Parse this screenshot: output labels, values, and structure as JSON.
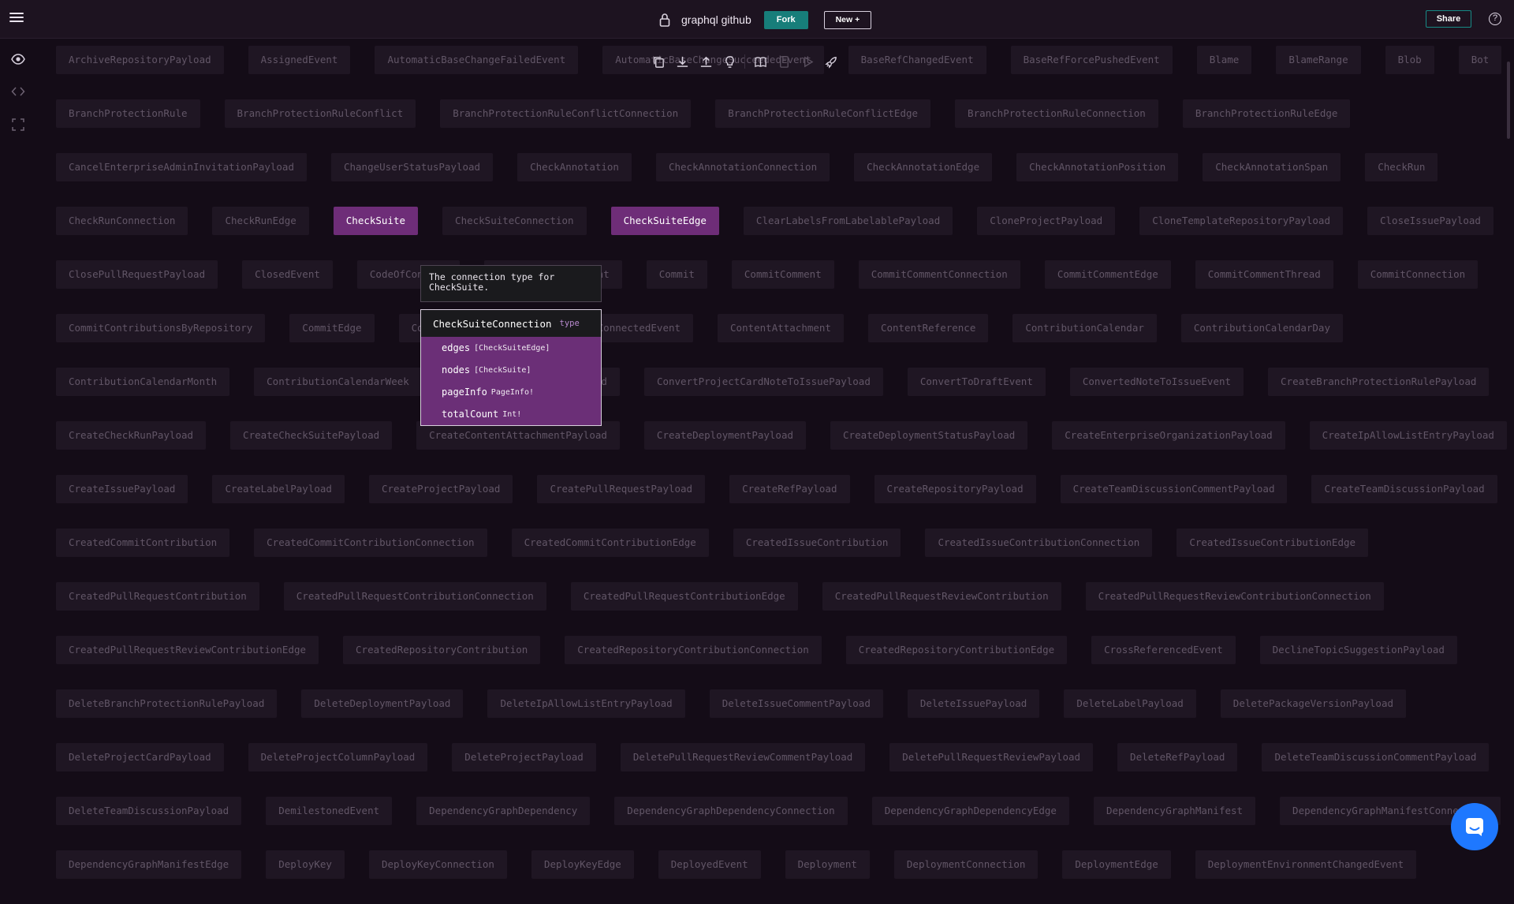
{
  "header": {
    "title": "graphql github",
    "fork_label": "Fork",
    "new_label": "New +",
    "share_label": "Share",
    "help_label": "?"
  },
  "rail": [
    "eye-icon",
    "code-icon",
    "fullscreen-icon"
  ],
  "toolbar": [
    "copy-icon",
    "download-icon",
    "upload-icon",
    "lightbulb-icon",
    "book-icon",
    "document-icon",
    "play-icon",
    "rocket-icon"
  ],
  "rows": [
    [
      "ArchiveRepositoryPayload",
      "AssignedEvent",
      "AutomaticBaseChangeFailedEvent",
      "AutomaticBaseChangeSucceededEvent",
      "BaseRefChangedEvent",
      "BaseRefForcePushedEvent",
      "Blame",
      "BlameRange",
      "Blob",
      "Bot"
    ],
    [
      "BranchProtectionRule",
      "BranchProtectionRuleConflict",
      "BranchProtectionRuleConflictConnection",
      "BranchProtectionRuleConflictEdge",
      "BranchProtectionRuleConnection",
      "BranchProtectionRuleEdge"
    ],
    [
      "CancelEnterpriseAdminInvitationPayload",
      "ChangeUserStatusPayload",
      "CheckAnnotation",
      "CheckAnnotationConnection",
      "CheckAnnotationEdge",
      "CheckAnnotationPosition",
      "CheckAnnotationSpan",
      "CheckRun"
    ],
    [
      "CheckRunConnection",
      "CheckRunEdge",
      "CheckSuite",
      "CheckSuiteConnection",
      "CheckSuiteEdge",
      "ClearLabelsFromLabelablePayload",
      "CloneProjectPayload",
      "CloneTemplateRepositoryPayload",
      "CloseIssuePayload"
    ],
    [
      "ClosePullRequestPayload",
      "ClosedEvent",
      "CodeOfConduct",
      "CommentDeletedEvent",
      "Commit",
      "CommitComment",
      "CommitCommentConnection",
      "CommitCommentEdge",
      "CommitCommentThread",
      "CommitConnection"
    ],
    [
      "CommitContributionsByRepository",
      "CommitEdge",
      "CommitHistoryConnection",
      "ConnectedEvent",
      "ContentAttachment",
      "ContentReference",
      "ContributionCalendar",
      "ContributionCalendarDay"
    ],
    [
      "ContributionCalendarMonth",
      "ContributionCalendarWeek",
      "ConvertNoteToIssuePayload",
      "ConvertProjectCardNoteToIssuePayload",
      "ConvertToDraftEvent",
      "ConvertedNoteToIssueEvent",
      "CreateBranchProtectionRulePayload"
    ],
    [
      "CreateCheckRunPayload",
      "CreateCheckSuitePayload",
      "CreateContentAttachmentPayload",
      "CreateDeploymentPayload",
      "CreateDeploymentStatusPayload",
      "CreateEnterpriseOrganizationPayload",
      "CreateIpAllowListEntryPayload"
    ],
    [
      "CreateIssuePayload",
      "CreateLabelPayload",
      "CreateProjectPayload",
      "CreatePullRequestPayload",
      "CreateRefPayload",
      "CreateRepositoryPayload",
      "CreateTeamDiscussionCommentPayload",
      "CreateTeamDiscussionPayload"
    ],
    [
      "CreatedCommitContribution",
      "CreatedCommitContributionConnection",
      "CreatedCommitContributionEdge",
      "CreatedIssueContribution",
      "CreatedIssueContributionConnection",
      "CreatedIssueContributionEdge"
    ],
    [
      "CreatedPullRequestContribution",
      "CreatedPullRequestContributionConnection",
      "CreatedPullRequestContributionEdge",
      "CreatedPullRequestReviewContribution",
      "CreatedPullRequestReviewContributionConnection"
    ],
    [
      "CreatedPullRequestReviewContributionEdge",
      "CreatedRepositoryContribution",
      "CreatedRepositoryContributionConnection",
      "CreatedRepositoryContributionEdge",
      "CrossReferencedEvent",
      "DeclineTopicSuggestionPayload"
    ],
    [
      "DeleteBranchProtectionRulePayload",
      "DeleteDeploymentPayload",
      "DeleteIpAllowListEntryPayload",
      "DeleteIssueCommentPayload",
      "DeleteIssuePayload",
      "DeleteLabelPayload",
      "DeletePackageVersionPayload"
    ],
    [
      "DeleteProjectCardPayload",
      "DeleteProjectColumnPayload",
      "DeleteProjectPayload",
      "DeletePullRequestReviewCommentPayload",
      "DeletePullRequestReviewPayload",
      "DeleteRefPayload",
      "DeleteTeamDiscussionCommentPayload"
    ],
    [
      "DeleteTeamDiscussionPayload",
      "DemilestonedEvent",
      "DependencyGraphDependency",
      "DependencyGraphDependencyConnection",
      "DependencyGraphDependencyEdge",
      "DependencyGraphManifest",
      "DependencyGraphManifestConnection"
    ],
    [
      "DependencyGraphManifestEdge",
      "DeployKey",
      "DeployKeyConnection",
      "DeployKeyEdge",
      "DeployedEvent",
      "Deployment",
      "DeploymentConnection",
      "DeploymentEdge",
      "DeploymentEnvironmentChangedEvent"
    ]
  ],
  "active_chips": [
    "CheckSuite",
    "CheckSuiteEdge"
  ],
  "tooltip": "The connection type for CheckSuite.",
  "popover": {
    "name": "CheckSuiteConnection",
    "kind": "type",
    "fields": [
      {
        "name": "edges",
        "type": "[CheckSuiteEdge]"
      },
      {
        "name": "nodes",
        "type": "[CheckSuite]"
      },
      {
        "name": "pageInfo",
        "type": "PageInfo!"
      },
      {
        "name": "totalCount",
        "type": "Int!"
      }
    ]
  }
}
